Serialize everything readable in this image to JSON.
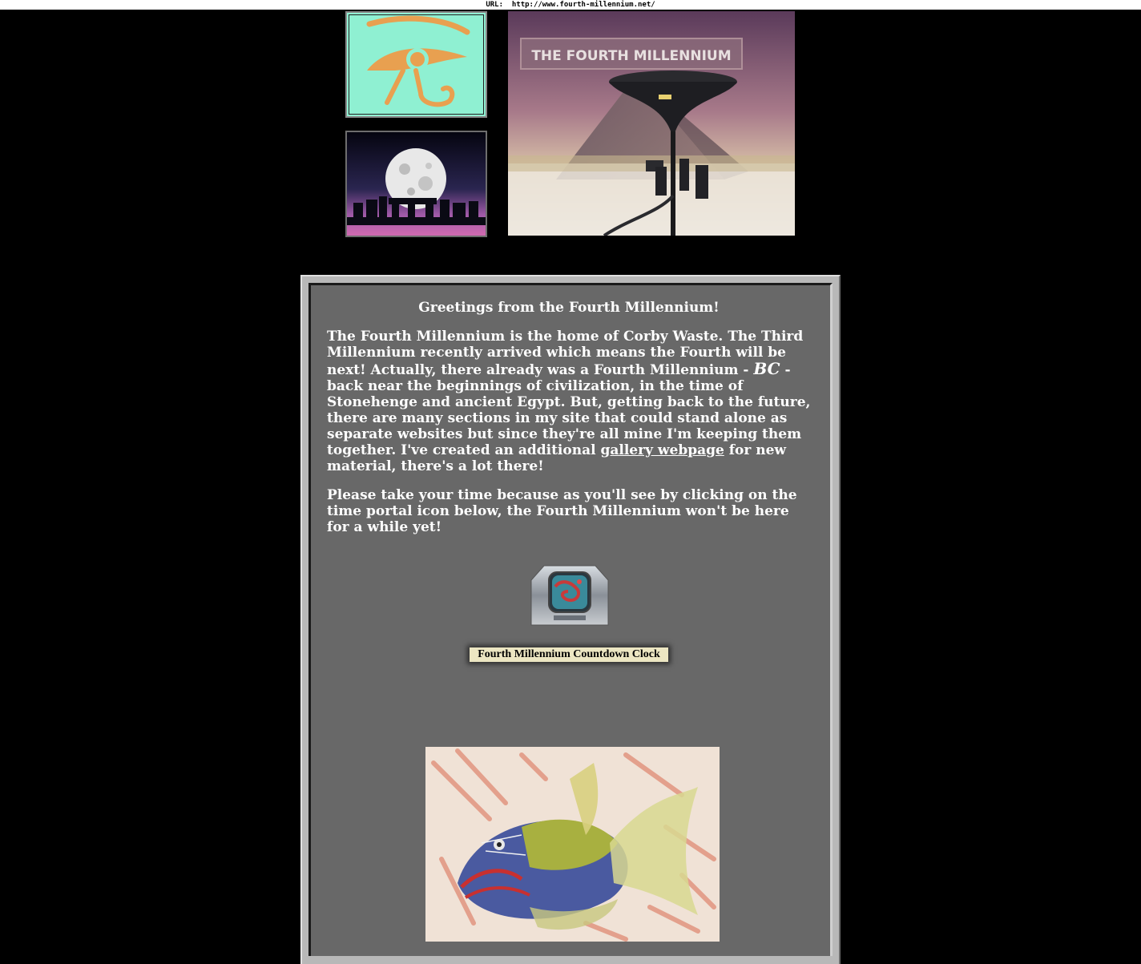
{
  "url_bar": {
    "label": "URL:",
    "url": "http://www.fourth-millennium.net/"
  },
  "hero": {
    "title": "THE FOURTH MILLENNIUM"
  },
  "main": {
    "heading": "Greetings from the Fourth Millennium!",
    "para1_part1": "The Fourth Millennium is the home of Corby Waste. The Third Millennium recently arrived which means the Fourth will be next! Actually, there already was a Fourth Millennium - ",
    "para1_bc": "BC",
    "para1_part2": " - back near the beginnings of civilization, in the time of Stonehenge and ancient Egypt. But, getting back to the future, there are many sections in my site that could stand alone as separate websites but since they're all mine I'm keeping them together. I've created an additional ",
    "gallery_link": "gallery webpage",
    "para1_part3": " for new material, there's a lot there!",
    "para2": "Please take your time because as you'll see by clicking on the time portal icon below, the Fourth Millennium won't be here for a while yet!",
    "countdown_label": "Fourth Millennium Countdown Clock"
  },
  "colors": {
    "page_bg": "#000000",
    "panel_bg": "#686868",
    "eye_bg": "#8ff0d2",
    "eye_color": "#e8a050"
  }
}
